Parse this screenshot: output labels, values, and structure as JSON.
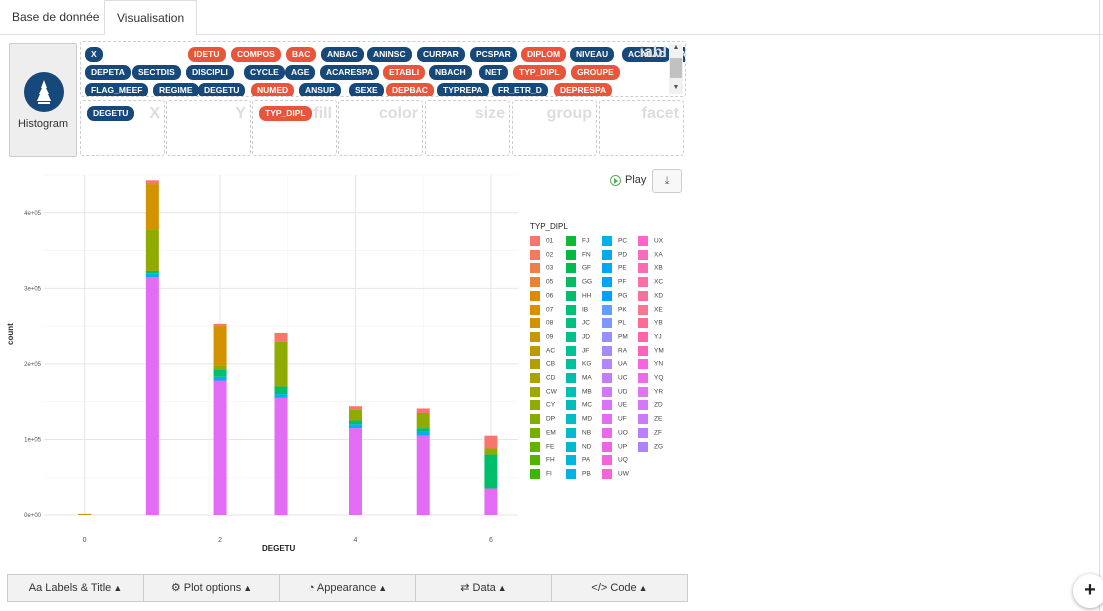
{
  "tabs": [
    {
      "label": "Base de donnée"
    },
    {
      "label": "Visualisation"
    }
  ],
  "geom": {
    "label": "Histogram",
    "icon": "histogram-icon"
  },
  "variables": {
    "ghost_label": "iabl",
    "badges": [
      {
        "label": "X",
        "color": "blue"
      },
      {
        "label": "IDETU",
        "color": "red"
      },
      {
        "label": "COMPOS",
        "color": "red"
      },
      {
        "label": "BAC",
        "color": "red"
      },
      {
        "label": "ANBAC",
        "color": "blue"
      },
      {
        "label": "ANINSC",
        "color": "blue"
      },
      {
        "label": "CURPAR",
        "color": "blue"
      },
      {
        "label": "PCSPAR",
        "color": "blue"
      },
      {
        "label": "DIPLOM",
        "color": "red"
      },
      {
        "label": "NIVEAU",
        "color": "blue"
      },
      {
        "label": "ACABAC",
        "color": "blue"
      },
      {
        "label": "ACAETA",
        "color": "blue"
      },
      {
        "label": "DEPETA",
        "color": "blue"
      },
      {
        "label": "SECTDIS",
        "color": "blue"
      },
      {
        "label": "DISCIPLI",
        "color": "blue"
      },
      {
        "label": "CYCLE",
        "color": "blue"
      },
      {
        "label": "AGE",
        "color": "blue"
      },
      {
        "label": "ACARESPA",
        "color": "blue"
      },
      {
        "label": "ETABLI",
        "color": "red"
      },
      {
        "label": "NBACH",
        "color": "blue"
      },
      {
        "label": "NET",
        "color": "blue"
      },
      {
        "label": "TYP_DIPL",
        "color": "red"
      },
      {
        "label": "GROUPE",
        "color": "red"
      },
      {
        "label": "FLAG_MEEF",
        "color": "blue"
      },
      {
        "label": "REGIME",
        "color": "blue"
      },
      {
        "label": "DEGETU",
        "color": "blue"
      },
      {
        "label": "NUMED",
        "color": "red"
      },
      {
        "label": "ANSUP",
        "color": "blue"
      },
      {
        "label": "SEXE",
        "color": "blue"
      },
      {
        "label": "DEPBAC",
        "color": "red"
      },
      {
        "label": "TYPREPA",
        "color": "blue"
      },
      {
        "label": "FR_ETR_D",
        "color": "blue"
      },
      {
        "label": "DEPRESPA",
        "color": "red"
      }
    ]
  },
  "dropzones": [
    {
      "label": "X",
      "value": "DEGETU",
      "color": "blue"
    },
    {
      "label": "Y",
      "value": "",
      "color": ""
    },
    {
      "label": "fill",
      "value": "TYP_DIPL",
      "color": "red"
    },
    {
      "label": "color",
      "value": "",
      "color": ""
    },
    {
      "label": "size",
      "value": "",
      "color": ""
    },
    {
      "label": "group",
      "value": "",
      "color": ""
    },
    {
      "label": "facet",
      "value": "",
      "color": ""
    }
  ],
  "controls": {
    "play_label": "Play",
    "download_icon": "download-icon"
  },
  "bottom_bar": [
    {
      "label": "Labels & Title",
      "icon": "font-icon"
    },
    {
      "label": "Plot options",
      "icon": "gear-icon"
    },
    {
      "label": "Appearance",
      "icon": "palette-icon"
    },
    {
      "label": "Data",
      "icon": "sliders-icon"
    },
    {
      "label": "Code",
      "icon": "code-icon"
    }
  ],
  "fab_label": "+",
  "chart_data": {
    "type": "bar",
    "stacked": true,
    "xlabel": "DEGETU",
    "ylabel": "count",
    "x_ticks": [
      "0",
      "2",
      "4",
      "6"
    ],
    "y_ticks": [
      "0e+00",
      "1e+05",
      "2e+05",
      "3e+05",
      "4e+05"
    ],
    "xlim": [
      -0.6,
      6.4
    ],
    "ylim": [
      0,
      450000
    ],
    "legend_title": "TYP_DIPL",
    "legend_position": "right",
    "legend_items": [
      "01",
      "02",
      "03",
      "05",
      "06",
      "07",
      "08",
      "09",
      "AC",
      "CB",
      "CD",
      "CW",
      "CY",
      "DP",
      "EM",
      "FE",
      "FH",
      "FI",
      "FJ",
      "FN",
      "GF",
      "GG",
      "HH",
      "IB",
      "JC",
      "JD",
      "JF",
      "KG",
      "MA",
      "MB",
      "MC",
      "MD",
      "NB",
      "ND",
      "PA",
      "PB",
      "PC",
      "PD",
      "PE",
      "PF",
      "PG",
      "PK",
      "PL",
      "PM",
      "RA",
      "UA",
      "UC",
      "UD",
      "UE",
      "UF",
      "UO",
      "UP",
      "UQ",
      "UW",
      "UX",
      "XA",
      "XB",
      "XC",
      "XD",
      "XE",
      "YB",
      "YJ",
      "YM",
      "YN",
      "YQ",
      "YR",
      "ZD",
      "ZE",
      "ZF",
      "ZG"
    ],
    "legend_colors": [
      "#f8766d",
      "#f47a5c",
      "#ef7f4a",
      "#ea8331",
      "#e38900",
      "#dc8d00",
      "#d39200",
      "#c99800",
      "#c09b00",
      "#b49f00",
      "#a9a400",
      "#9da700",
      "#8fab00",
      "#83ad00",
      "#75af00",
      "#64b200",
      "#53b400",
      "#3eb702",
      "#12b939",
      "#00ba40",
      "#00bb52",
      "#00bd5f",
      "#00be6c",
      "#00bf76",
      "#00c081",
      "#00c08b",
      "#00c196",
      "#00c0a0",
      "#00bfaa",
      "#00bfb3",
      "#00bdbc",
      "#00bcc5",
      "#00bacd",
      "#00b8d5",
      "#00b6dc",
      "#00b3e3",
      "#00b0e9",
      "#00acef",
      "#00a8f4",
      "#00a4f8",
      "#00a0fc",
      "#619cff",
      "#7e97ff",
      "#9590ff",
      "#a58aff",
      "#b584ff",
      "#c27dff",
      "#cf78ff",
      "#da72fb",
      "#e36cf5",
      "#ea67ee",
      "#f063e6",
      "#f563dd",
      "#f864d3",
      "#fa66c9",
      "#fc69be",
      "#fd6cb3",
      "#fc6fa8",
      "#fa729c",
      "#f8768f",
      "#ff6c91",
      "#ff66a8",
      "#ff62bc",
      "#f763e0",
      "#ea6bef",
      "#e076f4",
      "#d378f7",
      "#c87bfa",
      "#bb7efc",
      "#ae81fe"
    ],
    "bars": [
      {
        "x": 0,
        "segments": [
          {
            "color": "#c99800",
            "value": 1500
          }
        ]
      },
      {
        "x": 1,
        "segments": [
          {
            "color": "#e36cf5",
            "value": 315000
          },
          {
            "color": "#00b0e9",
            "value": 5000
          },
          {
            "color": "#00be6c",
            "value": 3000
          },
          {
            "color": "#8fab00",
            "value": 55000
          },
          {
            "color": "#d39200",
            "value": 60000
          },
          {
            "color": "#f8766d",
            "value": 5000
          }
        ]
      },
      {
        "x": 2,
        "segments": [
          {
            "color": "#e36cf5",
            "value": 178000
          },
          {
            "color": "#00b0e9",
            "value": 5000
          },
          {
            "color": "#00be6c",
            "value": 10000
          },
          {
            "color": "#8fab00",
            "value": 5000
          },
          {
            "color": "#d39200",
            "value": 53000
          },
          {
            "color": "#f8766d",
            "value": 2000
          }
        ]
      },
      {
        "x": 2.9,
        "segments": [
          {
            "color": "#e36cf5",
            "value": 155000
          },
          {
            "color": "#00b0e9",
            "value": 5000
          },
          {
            "color": "#00be6c",
            "value": 10000
          },
          {
            "color": "#8fab00",
            "value": 60000
          },
          {
            "color": "#f8766d",
            "value": 11000
          }
        ]
      },
      {
        "x": 4,
        "segments": [
          {
            "color": "#e36cf5",
            "value": 115000
          },
          {
            "color": "#00b0e9",
            "value": 5000
          },
          {
            "color": "#00be6c",
            "value": 5000
          },
          {
            "color": "#8fab00",
            "value": 15000
          },
          {
            "color": "#f8766d",
            "value": 4000
          }
        ]
      },
      {
        "x": 5,
        "segments": [
          {
            "color": "#e36cf5",
            "value": 105000
          },
          {
            "color": "#00b0e9",
            "value": 5000
          },
          {
            "color": "#00be6c",
            "value": 5000
          },
          {
            "color": "#8fab00",
            "value": 20000
          },
          {
            "color": "#f8766d",
            "value": 6000
          }
        ]
      },
      {
        "x": 6,
        "segments": [
          {
            "color": "#e36cf5",
            "value": 35000
          },
          {
            "color": "#00be6c",
            "value": 45000
          },
          {
            "color": "#8fab00",
            "value": 8000
          },
          {
            "color": "#f8766d",
            "value": 17000
          }
        ]
      }
    ]
  }
}
